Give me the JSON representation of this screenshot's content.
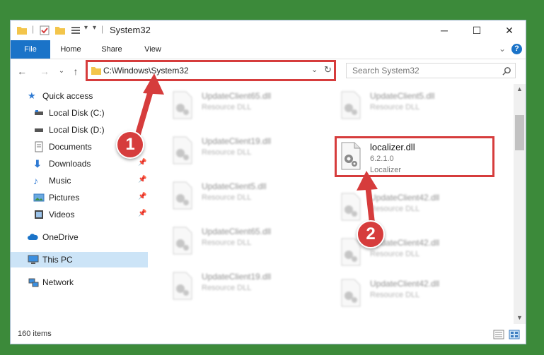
{
  "window": {
    "title": "System32",
    "controls": {
      "minimize": "─",
      "maximize": "☐",
      "close": "✕"
    }
  },
  "ribbon": {
    "tabs": [
      "File",
      "Home",
      "Share",
      "View"
    ],
    "expand_icon": "chevron-down-icon",
    "help_icon": "?"
  },
  "address": {
    "path": "C:\\Windows\\System32",
    "search_placeholder": "Search System32"
  },
  "nav": {
    "items": [
      {
        "label": "Quick access",
        "icon": "star-icon"
      },
      {
        "label": "Local Disk (C:)",
        "icon": "drive-icon"
      },
      {
        "label": "Local Disk (D:)",
        "icon": "drive-icon"
      },
      {
        "label": "Documents",
        "icon": "documents-icon"
      },
      {
        "label": "Downloads",
        "icon": "downloads-icon"
      },
      {
        "label": "Music",
        "icon": "music-icon"
      },
      {
        "label": "Pictures",
        "icon": "pictures-icon"
      },
      {
        "label": "Videos",
        "icon": "videos-icon"
      },
      {
        "label": "OneDrive",
        "icon": "cloud-icon"
      },
      {
        "label": "This PC",
        "icon": "computer-icon"
      },
      {
        "label": "Network",
        "icon": "network-icon"
      }
    ]
  },
  "files": {
    "left": [
      {
        "name": "UpdateClient65.dll",
        "type": "Resource DLL"
      },
      {
        "name": "UpdateClient19.dll",
        "type": "Resource DLL"
      },
      {
        "name": "UpdateClient5.dll",
        "type": "Resource DLL"
      },
      {
        "name": "UpdateClient65.dll",
        "type": "Resource DLL"
      },
      {
        "name": "UpdateClient19.dll",
        "type": "Resource DLL"
      }
    ],
    "right": [
      {
        "name": "UpdateClient5.dll",
        "type": "Resource DLL"
      },
      {
        "name": "localizer.dll",
        "version": "6.2.1.0",
        "type": "Localizer"
      },
      {
        "name": "UpdateClient42.dll",
        "type": "Resource DLL"
      },
      {
        "name": "UpdateClient42.dll",
        "type": "Resource DLL"
      },
      {
        "name": "UpdateClient42.dll",
        "type": "Resource DLL"
      }
    ]
  },
  "status": {
    "items_count": "160 items"
  },
  "annotations": {
    "step1": "1",
    "step2": "2",
    "color": "#d63c3c"
  },
  "colors": {
    "accent": "#1a73c8",
    "selection": "#cce4f7",
    "background": "#3c8a3a"
  }
}
